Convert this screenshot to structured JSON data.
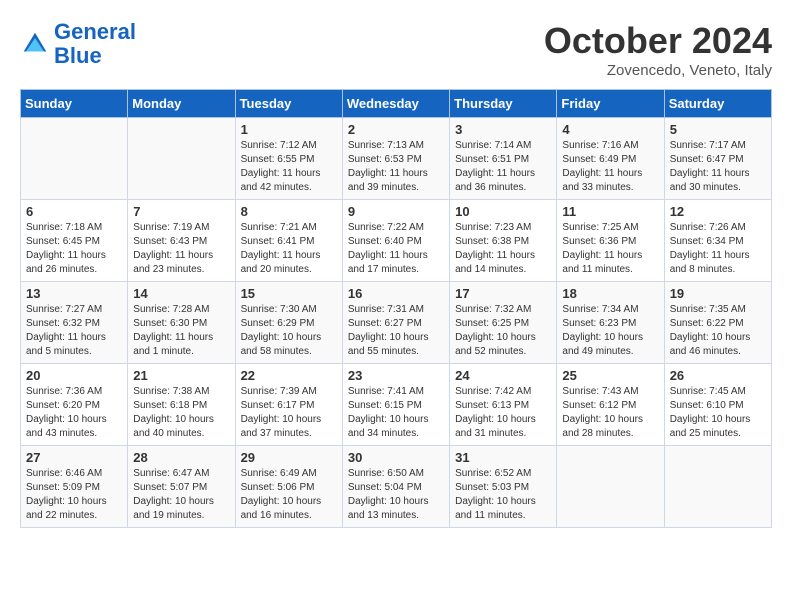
{
  "header": {
    "logo_line1": "General",
    "logo_line2": "Blue",
    "month_title": "October 2024",
    "location": "Zovencedo, Veneto, Italy"
  },
  "weekdays": [
    "Sunday",
    "Monday",
    "Tuesday",
    "Wednesday",
    "Thursday",
    "Friday",
    "Saturday"
  ],
  "weeks": [
    [
      {
        "day": "",
        "sunrise": "",
        "sunset": "",
        "daylight": ""
      },
      {
        "day": "",
        "sunrise": "",
        "sunset": "",
        "daylight": ""
      },
      {
        "day": "1",
        "sunrise": "Sunrise: 7:12 AM",
        "sunset": "Sunset: 6:55 PM",
        "daylight": "Daylight: 11 hours and 42 minutes."
      },
      {
        "day": "2",
        "sunrise": "Sunrise: 7:13 AM",
        "sunset": "Sunset: 6:53 PM",
        "daylight": "Daylight: 11 hours and 39 minutes."
      },
      {
        "day": "3",
        "sunrise": "Sunrise: 7:14 AM",
        "sunset": "Sunset: 6:51 PM",
        "daylight": "Daylight: 11 hours and 36 minutes."
      },
      {
        "day": "4",
        "sunrise": "Sunrise: 7:16 AM",
        "sunset": "Sunset: 6:49 PM",
        "daylight": "Daylight: 11 hours and 33 minutes."
      },
      {
        "day": "5",
        "sunrise": "Sunrise: 7:17 AM",
        "sunset": "Sunset: 6:47 PM",
        "daylight": "Daylight: 11 hours and 30 minutes."
      }
    ],
    [
      {
        "day": "6",
        "sunrise": "Sunrise: 7:18 AM",
        "sunset": "Sunset: 6:45 PM",
        "daylight": "Daylight: 11 hours and 26 minutes."
      },
      {
        "day": "7",
        "sunrise": "Sunrise: 7:19 AM",
        "sunset": "Sunset: 6:43 PM",
        "daylight": "Daylight: 11 hours and 23 minutes."
      },
      {
        "day": "8",
        "sunrise": "Sunrise: 7:21 AM",
        "sunset": "Sunset: 6:41 PM",
        "daylight": "Daylight: 11 hours and 20 minutes."
      },
      {
        "day": "9",
        "sunrise": "Sunrise: 7:22 AM",
        "sunset": "Sunset: 6:40 PM",
        "daylight": "Daylight: 11 hours and 17 minutes."
      },
      {
        "day": "10",
        "sunrise": "Sunrise: 7:23 AM",
        "sunset": "Sunset: 6:38 PM",
        "daylight": "Daylight: 11 hours and 14 minutes."
      },
      {
        "day": "11",
        "sunrise": "Sunrise: 7:25 AM",
        "sunset": "Sunset: 6:36 PM",
        "daylight": "Daylight: 11 hours and 11 minutes."
      },
      {
        "day": "12",
        "sunrise": "Sunrise: 7:26 AM",
        "sunset": "Sunset: 6:34 PM",
        "daylight": "Daylight: 11 hours and 8 minutes."
      }
    ],
    [
      {
        "day": "13",
        "sunrise": "Sunrise: 7:27 AM",
        "sunset": "Sunset: 6:32 PM",
        "daylight": "Daylight: 11 hours and 5 minutes."
      },
      {
        "day": "14",
        "sunrise": "Sunrise: 7:28 AM",
        "sunset": "Sunset: 6:30 PM",
        "daylight": "Daylight: 11 hours and 1 minute."
      },
      {
        "day": "15",
        "sunrise": "Sunrise: 7:30 AM",
        "sunset": "Sunset: 6:29 PM",
        "daylight": "Daylight: 10 hours and 58 minutes."
      },
      {
        "day": "16",
        "sunrise": "Sunrise: 7:31 AM",
        "sunset": "Sunset: 6:27 PM",
        "daylight": "Daylight: 10 hours and 55 minutes."
      },
      {
        "day": "17",
        "sunrise": "Sunrise: 7:32 AM",
        "sunset": "Sunset: 6:25 PM",
        "daylight": "Daylight: 10 hours and 52 minutes."
      },
      {
        "day": "18",
        "sunrise": "Sunrise: 7:34 AM",
        "sunset": "Sunset: 6:23 PM",
        "daylight": "Daylight: 10 hours and 49 minutes."
      },
      {
        "day": "19",
        "sunrise": "Sunrise: 7:35 AM",
        "sunset": "Sunset: 6:22 PM",
        "daylight": "Daylight: 10 hours and 46 minutes."
      }
    ],
    [
      {
        "day": "20",
        "sunrise": "Sunrise: 7:36 AM",
        "sunset": "Sunset: 6:20 PM",
        "daylight": "Daylight: 10 hours and 43 minutes."
      },
      {
        "day": "21",
        "sunrise": "Sunrise: 7:38 AM",
        "sunset": "Sunset: 6:18 PM",
        "daylight": "Daylight: 10 hours and 40 minutes."
      },
      {
        "day": "22",
        "sunrise": "Sunrise: 7:39 AM",
        "sunset": "Sunset: 6:17 PM",
        "daylight": "Daylight: 10 hours and 37 minutes."
      },
      {
        "day": "23",
        "sunrise": "Sunrise: 7:41 AM",
        "sunset": "Sunset: 6:15 PM",
        "daylight": "Daylight: 10 hours and 34 minutes."
      },
      {
        "day": "24",
        "sunrise": "Sunrise: 7:42 AM",
        "sunset": "Sunset: 6:13 PM",
        "daylight": "Daylight: 10 hours and 31 minutes."
      },
      {
        "day": "25",
        "sunrise": "Sunrise: 7:43 AM",
        "sunset": "Sunset: 6:12 PM",
        "daylight": "Daylight: 10 hours and 28 minutes."
      },
      {
        "day": "26",
        "sunrise": "Sunrise: 7:45 AM",
        "sunset": "Sunset: 6:10 PM",
        "daylight": "Daylight: 10 hours and 25 minutes."
      }
    ],
    [
      {
        "day": "27",
        "sunrise": "Sunrise: 6:46 AM",
        "sunset": "Sunset: 5:09 PM",
        "daylight": "Daylight: 10 hours and 22 minutes."
      },
      {
        "day": "28",
        "sunrise": "Sunrise: 6:47 AM",
        "sunset": "Sunset: 5:07 PM",
        "daylight": "Daylight: 10 hours and 19 minutes."
      },
      {
        "day": "29",
        "sunrise": "Sunrise: 6:49 AM",
        "sunset": "Sunset: 5:06 PM",
        "daylight": "Daylight: 10 hours and 16 minutes."
      },
      {
        "day": "30",
        "sunrise": "Sunrise: 6:50 AM",
        "sunset": "Sunset: 5:04 PM",
        "daylight": "Daylight: 10 hours and 13 minutes."
      },
      {
        "day": "31",
        "sunrise": "Sunrise: 6:52 AM",
        "sunset": "Sunset: 5:03 PM",
        "daylight": "Daylight: 10 hours and 11 minutes."
      },
      {
        "day": "",
        "sunrise": "",
        "sunset": "",
        "daylight": ""
      },
      {
        "day": "",
        "sunrise": "",
        "sunset": "",
        "daylight": ""
      }
    ]
  ]
}
